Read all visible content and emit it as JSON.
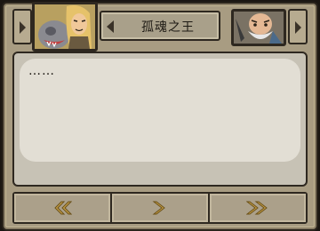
{
  "header": {
    "speaker_name": "孤魂之王",
    "active_portrait": "hero-portrait-icon",
    "other_portrait": "bald-elder-portrait-icon"
  },
  "dialog": {
    "text": "……"
  },
  "nav": {
    "back_icon": "double-chevron-left-icon",
    "next_icon": "chevron-right-icon",
    "skip_icon": "double-chevron-right-icon"
  },
  "colors": {
    "frame": "#a89c82",
    "dialog_bg": "#e2ded4",
    "arrow_gold": "#c9a24a"
  }
}
